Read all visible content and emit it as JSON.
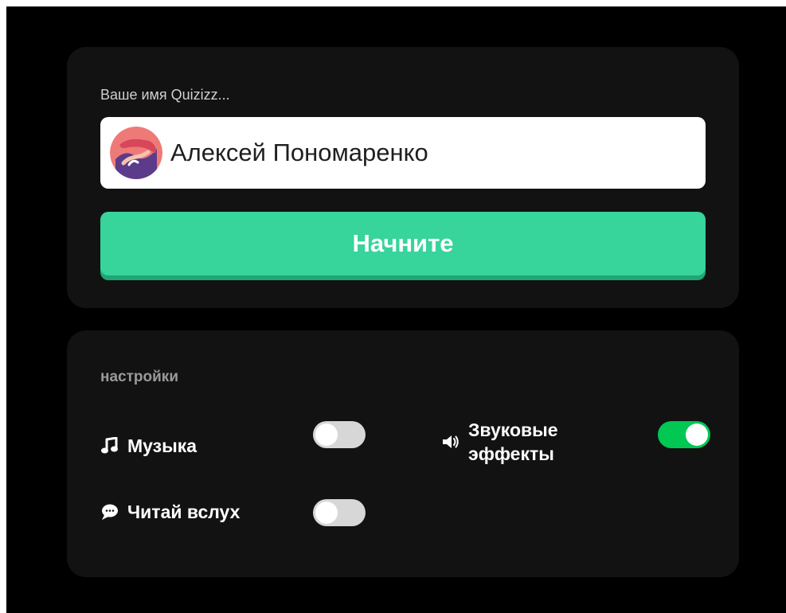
{
  "profile": {
    "name_label": "Ваше имя Quizizz...",
    "name_value": "Алексей Пономаренко",
    "avatar_icon": "avatar-illustration-icon"
  },
  "actions": {
    "start_label": "Начните",
    "start_color": "#37d49c"
  },
  "settings": {
    "title": "настройки",
    "music": {
      "label": "Музыка",
      "icon": "music-note-icon",
      "enabled": false
    },
    "read_aloud": {
      "label": "Читай вслух",
      "icon": "chat-bubble-icon",
      "enabled": false
    },
    "sound_effects": {
      "label_line1": "Звуковые",
      "label_line2": "эффекты",
      "icon": "speaker-icon",
      "enabled": true
    }
  },
  "colors": {
    "background": "#000000",
    "card": "#121212",
    "toggle_on": "#00c853",
    "toggle_off": "#d7d7d7"
  }
}
